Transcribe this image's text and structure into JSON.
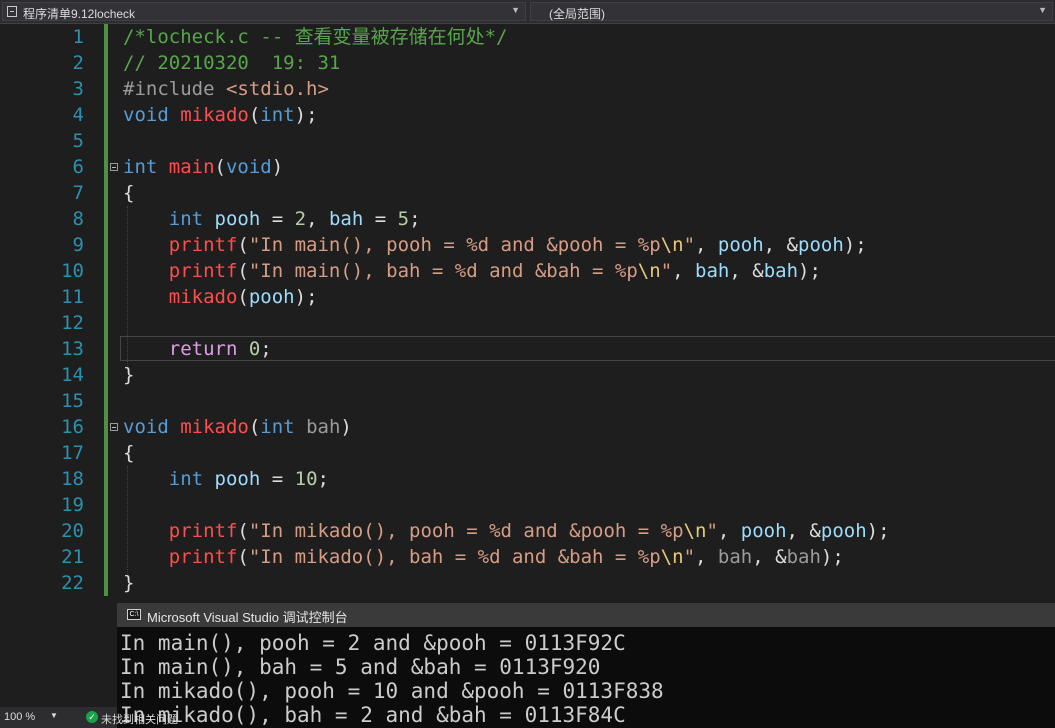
{
  "navbar": {
    "file_scope": "程序清单9.12locheck",
    "global_scope": "(全局范围)"
  },
  "editor": {
    "line_numbers": [
      "1",
      "2",
      "3",
      "4",
      "5",
      "6",
      "7",
      "8",
      "9",
      "10",
      "11",
      "12",
      "13",
      "14",
      "15",
      "16",
      "17",
      "18",
      "19",
      "20",
      "21",
      "22"
    ],
    "lines": [
      [
        {
          "t": "/*locheck.c -- 查看变量被存储在何处*/",
          "c": "com"
        }
      ],
      [
        {
          "t": "// 20210320  19: 31",
          "c": "com"
        }
      ],
      [
        {
          "t": "#include ",
          "c": "pre"
        },
        {
          "t": "<stdio.h>",
          "c": "inc"
        }
      ],
      [
        {
          "t": "void ",
          "c": "kw"
        },
        {
          "t": "mikado",
          "c": "fn"
        },
        {
          "t": "(",
          "c": "plain"
        },
        {
          "t": "int",
          "c": "kw"
        },
        {
          "t": ");",
          "c": "plain"
        }
      ],
      [],
      [
        {
          "t": "int ",
          "c": "kw"
        },
        {
          "t": "main",
          "c": "fn"
        },
        {
          "t": "(",
          "c": "plain"
        },
        {
          "t": "void",
          "c": "kw"
        },
        {
          "t": ")",
          "c": "plain"
        }
      ],
      [
        {
          "t": "{",
          "c": "plain"
        }
      ],
      [
        {
          "t": "    ",
          "c": "plain"
        },
        {
          "t": "int ",
          "c": "kw"
        },
        {
          "t": "pooh",
          "c": "var"
        },
        {
          "t": " = ",
          "c": "plain"
        },
        {
          "t": "2",
          "c": "num"
        },
        {
          "t": ", ",
          "c": "plain"
        },
        {
          "t": "bah",
          "c": "var"
        },
        {
          "t": " = ",
          "c": "plain"
        },
        {
          "t": "5",
          "c": "num"
        },
        {
          "t": ";",
          "c": "plain"
        }
      ],
      [
        {
          "t": "    ",
          "c": "plain"
        },
        {
          "t": "printf",
          "c": "fn"
        },
        {
          "t": "(",
          "c": "plain"
        },
        {
          "t": "\"In main(), pooh = %d and &pooh = %p",
          "c": "str"
        },
        {
          "t": "\\n",
          "c": "esc"
        },
        {
          "t": "\"",
          "c": "str"
        },
        {
          "t": ", ",
          "c": "plain"
        },
        {
          "t": "pooh",
          "c": "var"
        },
        {
          "t": ", &",
          "c": "plain"
        },
        {
          "t": "pooh",
          "c": "var"
        },
        {
          "t": ");",
          "c": "plain"
        }
      ],
      [
        {
          "t": "    ",
          "c": "plain"
        },
        {
          "t": "printf",
          "c": "fn"
        },
        {
          "t": "(",
          "c": "plain"
        },
        {
          "t": "\"In main(), bah = %d and &bah = %p",
          "c": "str"
        },
        {
          "t": "\\n",
          "c": "esc"
        },
        {
          "t": "\"",
          "c": "str"
        },
        {
          "t": ", ",
          "c": "plain"
        },
        {
          "t": "bah",
          "c": "var"
        },
        {
          "t": ", &",
          "c": "plain"
        },
        {
          "t": "bah",
          "c": "var"
        },
        {
          "t": ");",
          "c": "plain"
        }
      ],
      [
        {
          "t": "    ",
          "c": "plain"
        },
        {
          "t": "mikado",
          "c": "fn"
        },
        {
          "t": "(",
          "c": "plain"
        },
        {
          "t": "pooh",
          "c": "var"
        },
        {
          "t": ");",
          "c": "plain"
        }
      ],
      [],
      [
        {
          "t": "    ",
          "c": "plain"
        },
        {
          "t": "return ",
          "c": "ctl"
        },
        {
          "t": "0",
          "c": "num"
        },
        {
          "t": ";",
          "c": "plain"
        }
      ],
      [
        {
          "t": "}",
          "c": "plain"
        }
      ],
      [],
      [
        {
          "t": "void ",
          "c": "kw"
        },
        {
          "t": "mikado",
          "c": "fn"
        },
        {
          "t": "(",
          "c": "plain"
        },
        {
          "t": "int ",
          "c": "kw"
        },
        {
          "t": "bah",
          "c": "gray"
        },
        {
          "t": ")",
          "c": "plain"
        }
      ],
      [
        {
          "t": "{",
          "c": "plain"
        }
      ],
      [
        {
          "t": "    ",
          "c": "plain"
        },
        {
          "t": "int ",
          "c": "kw"
        },
        {
          "t": "pooh",
          "c": "var"
        },
        {
          "t": " = ",
          "c": "plain"
        },
        {
          "t": "10",
          "c": "num"
        },
        {
          "t": ";",
          "c": "plain"
        }
      ],
      [],
      [
        {
          "t": "    ",
          "c": "plain"
        },
        {
          "t": "printf",
          "c": "fn"
        },
        {
          "t": "(",
          "c": "plain"
        },
        {
          "t": "\"In mikado(), pooh = %d and &pooh = %p",
          "c": "str"
        },
        {
          "t": "\\n",
          "c": "esc"
        },
        {
          "t": "\"",
          "c": "str"
        },
        {
          "t": ", ",
          "c": "plain"
        },
        {
          "t": "pooh",
          "c": "var"
        },
        {
          "t": ", &",
          "c": "plain"
        },
        {
          "t": "pooh",
          "c": "var"
        },
        {
          "t": ");",
          "c": "plain"
        }
      ],
      [
        {
          "t": "    ",
          "c": "plain"
        },
        {
          "t": "printf",
          "c": "fn"
        },
        {
          "t": "(",
          "c": "plain"
        },
        {
          "t": "\"In mikado(), bah = %d and &bah = %p",
          "c": "str"
        },
        {
          "t": "\\n",
          "c": "esc"
        },
        {
          "t": "\"",
          "c": "str"
        },
        {
          "t": ", ",
          "c": "plain"
        },
        {
          "t": "bah",
          "c": "gray"
        },
        {
          "t": ", &",
          "c": "plain"
        },
        {
          "t": "bah",
          "c": "gray"
        },
        {
          "t": ");",
          "c": "plain"
        }
      ],
      [
        {
          "t": "}",
          "c": "plain"
        }
      ]
    ]
  },
  "console": {
    "title": "Microsoft Visual Studio 调试控制台",
    "icon": "console-window-icon",
    "icon_text": "C:\\",
    "lines": [
      "In main(), pooh = 2 and &pooh = 0113F92C",
      "In main(), bah = 5 and &bah = 0113F920",
      "In mikado(), pooh = 10 and &pooh = 0113F838",
      "In mikado(), bah = 2 and &bah = 0113F84C"
    ]
  },
  "statusbar": {
    "zoom": "100 %",
    "status_text": "未找到相关问题"
  },
  "colors": {
    "comment": "#57a64a",
    "keyword": "#569cd6",
    "function": "#ff4d4d",
    "variable": "#9cdcfe",
    "number": "#b5cea8",
    "string": "#d69d85",
    "line_number": "#2b91af",
    "background": "#1e1e1e"
  }
}
